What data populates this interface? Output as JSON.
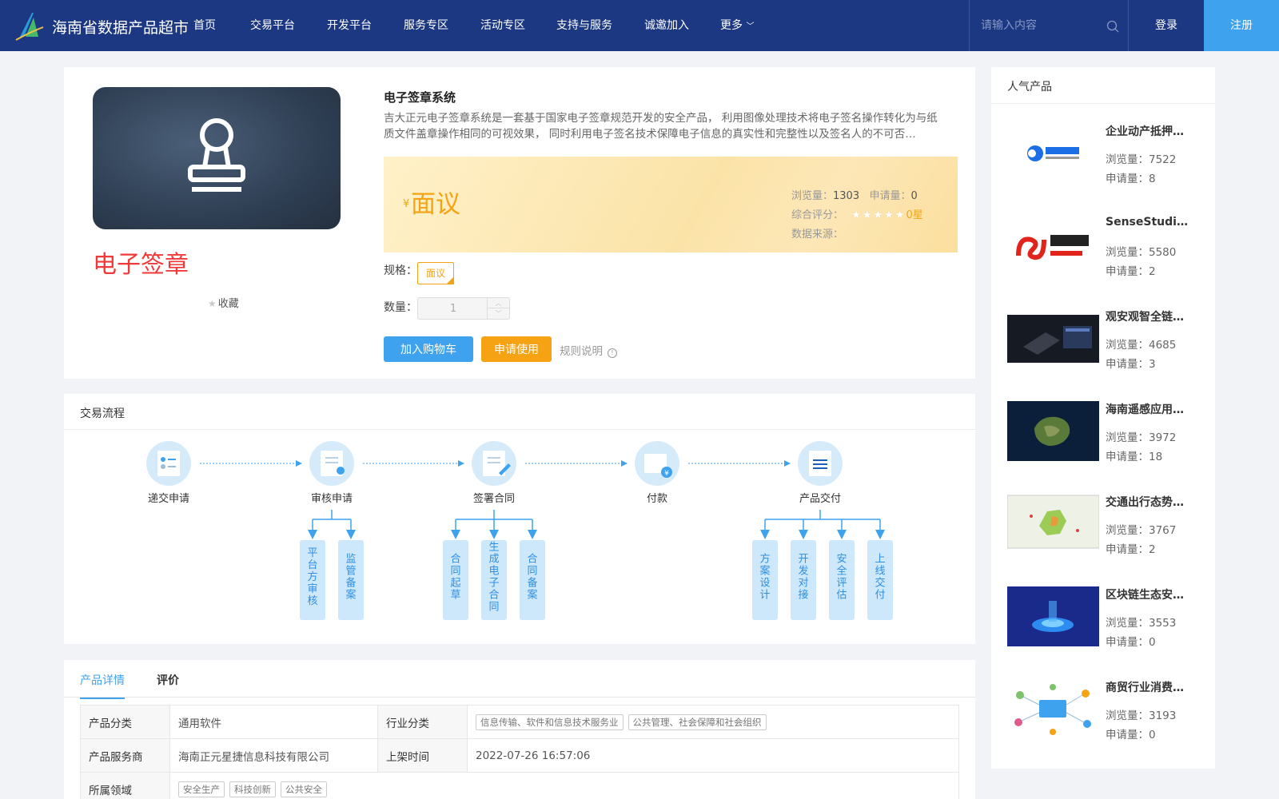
{
  "header": {
    "site_title": "海南省数据产品超市",
    "nav": [
      "首页",
      "交易平台",
      "开发平台",
      "服务专区",
      "活动专区",
      "支持与服务",
      "诚邀加入",
      "更多"
    ],
    "search_placeholder": "请输入内容",
    "login": "登录",
    "register": "注册"
  },
  "product": {
    "image_label": "电子签章",
    "favorite": "收藏",
    "title": "电子签章系统",
    "description": "吉大正元电子签章系统是一套基于国家电子签章规范开发的安全产品， 利用图像处理技术将电子签名操作转化为与纸质文件盖章操作相同的可视效果， 同时利用电子签名技术保障电子信息的真实性和完整性以及签名人的不可否…",
    "price_symbol": "¥",
    "price": "面议",
    "views_label": "浏览量：",
    "views": "1303",
    "applies_label": "申请量：",
    "applies": "0",
    "rating_label": "综合评分：",
    "rating_text": "0星",
    "rating": 0,
    "source_label": "数据来源：",
    "source": "",
    "spec_label": "规格：",
    "spec_value": "面议",
    "qty_label": "数量：",
    "qty_value": "1",
    "add_cart": "加入购物车",
    "apply": "申请使用",
    "rules": "规则说明"
  },
  "flow": {
    "title": "交易流程",
    "steps": [
      "递交申请",
      "审核申请",
      "签署合同",
      "付款",
      "产品交付"
    ],
    "sub_review": [
      "平台方审核",
      "监管备案"
    ],
    "sub_contract": [
      "合同起草",
      "生成电子合同",
      "合同备案"
    ],
    "sub_delivery": [
      "方案设计",
      "开发对接",
      "安全评估",
      "上线交付"
    ]
  },
  "detail": {
    "tabs": [
      "产品详情",
      "评价"
    ],
    "rows": {
      "category_label": "产品分类",
      "category": "通用软件",
      "industry_label": "行业分类",
      "industry_tags": [
        "信息传输、软件和信息技术服务业",
        "公共管理、社会保障和社会组织"
      ],
      "provider_label": "产品服务商",
      "provider": "海南正元星捷信息科技有限公司",
      "listed_label": "上架时间",
      "listed": "2022-07-26 16:57:06",
      "domain_label": "所属领域",
      "domain_tags": [
        "安全生产",
        "科技创新",
        "公共安全"
      ]
    }
  },
  "sidebar": {
    "title": "人气产品",
    "views_label": "浏览量：",
    "applies_label": "申请量：",
    "items": [
      {
        "name": "企业动产抵押…",
        "views": "7522",
        "applies": "8",
        "thumb": "tianyancha-logo"
      },
      {
        "name": "SenseStudio…",
        "views": "5580",
        "applies": "2",
        "thumb": "sensetime-logo"
      },
      {
        "name": "观安观智全链…",
        "views": "4685",
        "applies": "3",
        "thumb": "device-photo"
      },
      {
        "name": "海南遥感应用…",
        "views": "3972",
        "applies": "18",
        "thumb": "satellite-map"
      },
      {
        "name": "交通出行态势…",
        "views": "3767",
        "applies": "2",
        "thumb": "region-map"
      },
      {
        "name": "区块链生态安…",
        "views": "3553",
        "applies": "0",
        "thumb": "blockchain-art"
      },
      {
        "name": "商贸行业消费…",
        "views": "3193",
        "applies": "0",
        "thumb": "network-diagram"
      }
    ]
  },
  "colors": {
    "header_bg": "#1c3882",
    "accent_blue": "#3fa2ef",
    "accent_orange": "#f6a313",
    "stamp_red": "#f03a3a"
  }
}
